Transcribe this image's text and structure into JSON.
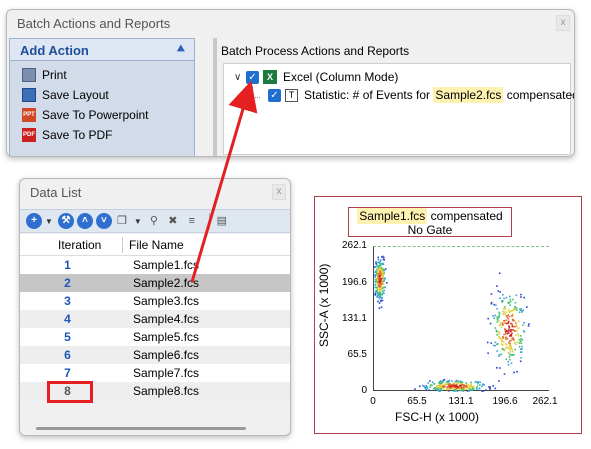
{
  "batch_window": {
    "title": "Batch Actions and Reports",
    "close": "x",
    "add_action": {
      "header": "Add Action",
      "items": [
        {
          "label": "Print",
          "icon": "print-icon"
        },
        {
          "label": "Save Layout",
          "icon": "save-icon"
        },
        {
          "label": "Save To Powerpoint",
          "icon": "powerpoint-icon"
        },
        {
          "label": "Save To PDF",
          "icon": "pdf-icon"
        }
      ]
    },
    "heading": "Batch Process Actions and Reports",
    "tree": {
      "root": {
        "label": "Excel (Column Mode)",
        "checked": true
      },
      "child": {
        "prefix": "Statistic: # of Events for ",
        "highlight": "Sample2.fcs",
        "suffix": " compensated",
        "checked": true
      }
    }
  },
  "data_list": {
    "title": "Data List",
    "close": "x",
    "columns": [
      "Iteration",
      "File Name"
    ],
    "rows": [
      {
        "iteration": "1",
        "file": "Sample1.fcs"
      },
      {
        "iteration": "2",
        "file": "Sample2.fcs"
      },
      {
        "iteration": "3",
        "file": "Sample3.fcs"
      },
      {
        "iteration": "4",
        "file": "Sample4.fcs"
      },
      {
        "iteration": "5",
        "file": "Sample5.fcs"
      },
      {
        "iteration": "6",
        "file": "Sample6.fcs"
      },
      {
        "iteration": "7",
        "file": "Sample7.fcs"
      },
      {
        "iteration": "8",
        "file": "Sample8.fcs"
      }
    ],
    "selected_row": 2,
    "highlighted_iteration": "8"
  },
  "plot": {
    "title_highlight": "Sample1.fcs",
    "title_rest": " compensated",
    "subtitle": "No Gate",
    "xlabel": "FSC-H (x 1000)",
    "ylabel": "SSC-A (x 1000)",
    "yticks": [
      "262.1",
      "196.6",
      "131.1",
      "65.5",
      "0"
    ],
    "xticks": [
      "0",
      "65.5",
      "131.1",
      "196.6",
      "262.1"
    ]
  },
  "chart_data": {
    "type": "scatter",
    "title": "Sample1.fcs compensated",
    "subtitle": "No Gate",
    "xlabel": "FSC-H (x 1000)",
    "ylabel": "SSC-A (x 1000)",
    "xlim": [
      0,
      262.1
    ],
    "ylim": [
      0,
      262.1
    ],
    "clusters": [
      {
        "name": "",
        "x_center": 8,
        "y_center": 205,
        "spread": [
          8,
          35
        ]
      },
      {
        "name": "",
        "x_center": 200,
        "y_center": 115,
        "spread": [
          25,
          65
        ]
      },
      {
        "name": "",
        "x_center": 120,
        "y_center": 12,
        "spread": [
          45,
          10
        ]
      }
    ]
  }
}
